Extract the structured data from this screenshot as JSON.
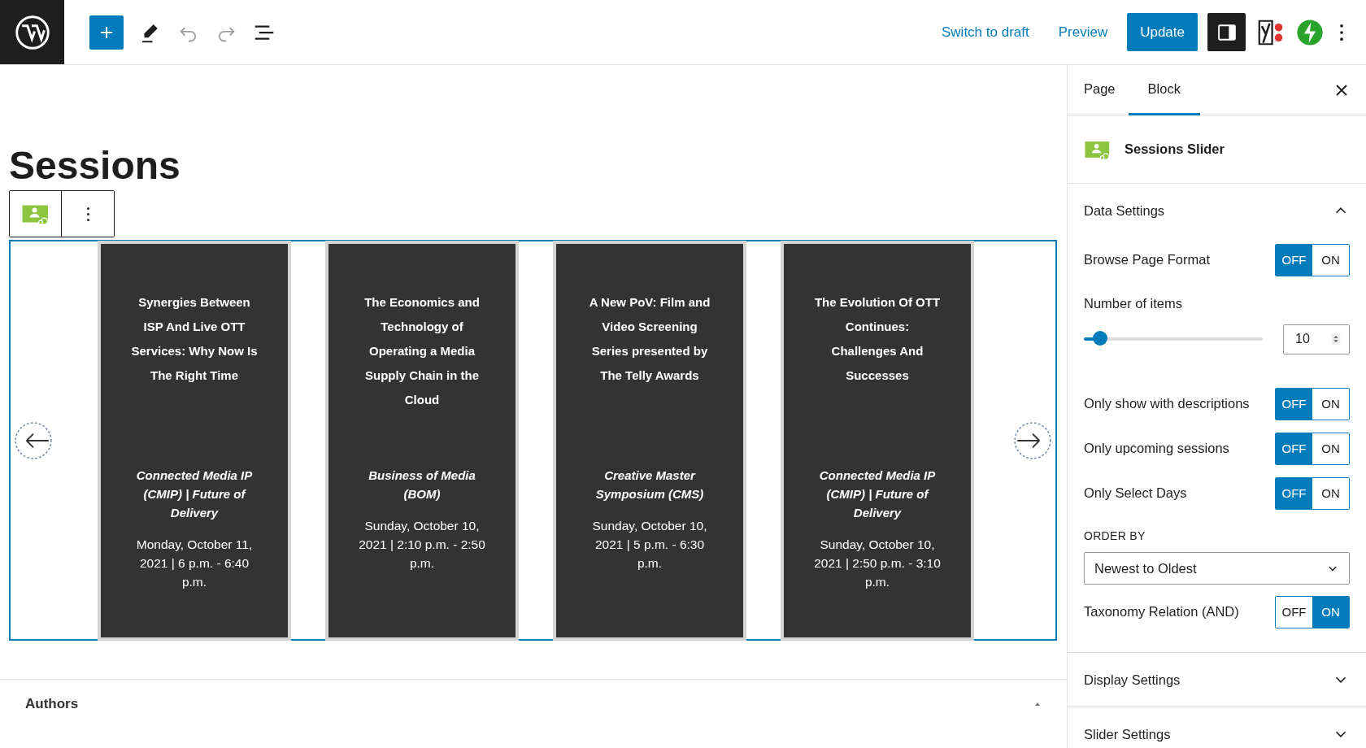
{
  "topbar": {
    "links": [
      "Switch to draft",
      "Preview"
    ],
    "update": "Update",
    "settings_selected": true
  },
  "editor": {
    "title": "Sessions",
    "sessions": [
      {
        "title": "Synergies Between ISP And Live OTT Services: Why Now Is The Right Time",
        "track": "Connected Media IP (CMIP) | Future of Delivery",
        "date": "Monday, October 11, 2021 | 6 p.m. - 6:40 p.m."
      },
      {
        "title": "The Economics and Technology of Operating a Media Supply Chain in the Cloud",
        "track": "Business of Media (BOM)",
        "date": "Sunday, October 10, 2021 | 2:10 p.m. - 2:50 p.m."
      },
      {
        "title": "A New PoV: Film and Video Screening Series presented by The Telly Awards",
        "track": "Creative Master Symposium (CMS)",
        "date": "Sunday, October 10, 2021 | 5 p.m. - 6:30 p.m."
      },
      {
        "title": "The Evolution Of OTT Continues: Challenges And Successes",
        "track": "Connected Media IP (CMIP) | Future of Delivery",
        "date": "Sunday, October 10, 2021 | 2:50 p.m. - 3:10 p.m."
      }
    ],
    "block_selected": true,
    "authors": {
      "heading": "Authors",
      "expanded": true
    }
  },
  "sidebar": {
    "tabs": [
      {
        "label": "Page",
        "selected": false
      },
      {
        "label": "Block",
        "selected": true
      }
    ],
    "block_name": "Sessions Slider",
    "panels": [
      {
        "title": "Data Settings",
        "expanded": true,
        "settings": [
          {
            "kind": "toggle",
            "label": "Browse Page Format",
            "on": false,
            "off_label": "OFF",
            "on_label": "ON"
          },
          {
            "kind": "range",
            "label": "Number of items",
            "level": 0.09,
            "value": "10"
          },
          {
            "kind": "toggle",
            "label": "Only show with descriptions",
            "on": false,
            "off_label": "OFF",
            "on_label": "ON"
          },
          {
            "kind": "toggle",
            "label": "Only upcoming sessions",
            "on": false,
            "off_label": "OFF",
            "on_label": "ON"
          },
          {
            "kind": "toggle",
            "label": "Only Select Days",
            "on": false,
            "off_label": "OFF",
            "on_label": "ON"
          },
          {
            "kind": "select",
            "label": "ORDER BY",
            "value": "Newest to Oldest"
          },
          {
            "kind": "toggle",
            "label": "Taxonomy Relation (AND)",
            "on": true,
            "off_label": "OFF",
            "on_label": "ON"
          }
        ]
      },
      {
        "title": "Display Settings",
        "expanded": false
      },
      {
        "title": "Slider Settings",
        "expanded": false
      }
    ]
  }
}
